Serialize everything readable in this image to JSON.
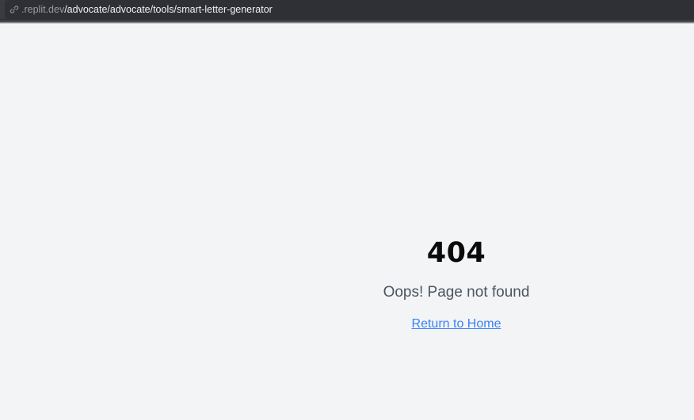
{
  "browser": {
    "url_host": ".replit.dev",
    "url_path": "/advocate/advocate/tools/smart-letter-generator",
    "icon": "link-icon"
  },
  "error": {
    "code": "404",
    "message": "Oops! Page not found",
    "home_link_label": "Return to Home"
  },
  "colors": {
    "page_background": "#f3f4f6",
    "link": "#3b82f6",
    "message_text": "#4b5563"
  }
}
